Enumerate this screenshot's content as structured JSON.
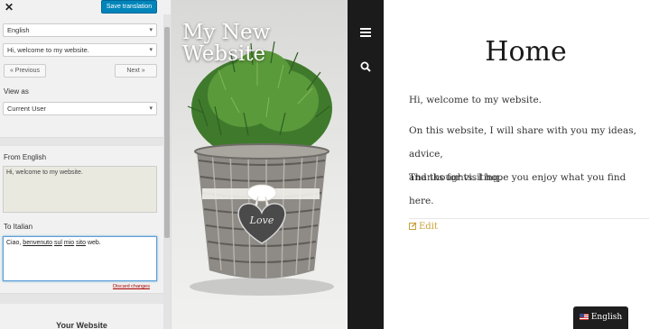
{
  "editor": {
    "close_icon": "close-icon",
    "save_label": "Save translation",
    "language_select": "English",
    "string_select": "Hi, welcome to my website.",
    "prev_label": "« Previous",
    "next_label": "Next »",
    "view_as_label": "View as",
    "view_as_select": "Current User",
    "from_label": "From English",
    "from_text": "Hi, welcome to my website.",
    "to_label": "To Italian",
    "to_text_parts": [
      "Ciao, ",
      "benvenuto",
      " ",
      "sul",
      " ",
      "mio",
      " ",
      "sito",
      " web."
    ],
    "discard_label": "Discard changes",
    "your_website_label": "Your Website"
  },
  "hero": {
    "site_title_line1": "My New",
    "site_title_line2": "Website",
    "image_subject": "potted plant in wicker basket with heart tag",
    "tag_text": "Love"
  },
  "strip": {
    "menu_icon": "hamburger-icon",
    "search_icon": "search-icon"
  },
  "page": {
    "title": "Home",
    "p1": "Hi, welcome to my website.",
    "p2_line1": "On this website, I will share with you my ideas, advice,",
    "p2_line2": "and thoughts. I hope you enjoy what you find here.",
    "p3": "Thanks for visiting.",
    "edit_label": "Edit",
    "accent_color": "#c9a23a",
    "language_switcher_label": "English"
  }
}
